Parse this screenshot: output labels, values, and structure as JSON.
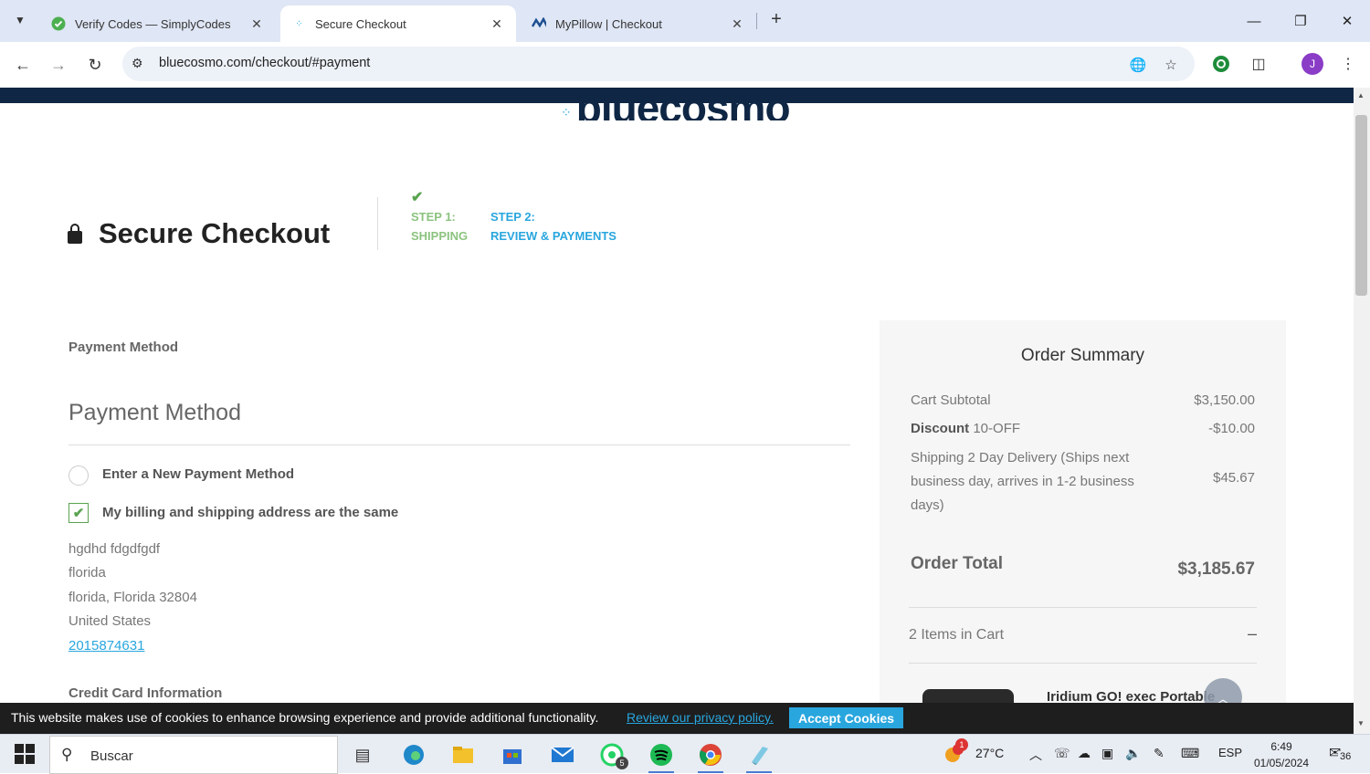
{
  "browser": {
    "tabs": [
      {
        "title": "Verify Codes — SimplyCodes",
        "icon": "simplycodes-icon",
        "active": false
      },
      {
        "title": "Secure Checkout",
        "icon": "bluecosmo-dots-icon",
        "active": true
      },
      {
        "title": "MyPillow | Checkout",
        "icon": "mypillow-icon",
        "active": false
      }
    ],
    "url": "bluecosmo.com/checkout/#payment",
    "profile_initial": "J"
  },
  "page": {
    "logo_text": "bluecosmo",
    "title": "Secure Checkout",
    "steps": [
      {
        "label": "STEP 1:",
        "name": "SHIPPING",
        "done": true
      },
      {
        "label": "STEP 2:",
        "name": "REVIEW & PAYMENTS",
        "done": false
      }
    ],
    "payment": {
      "section_label": "Payment Method",
      "heading": "Payment Method",
      "new_method_label": "Enter a New Payment Method",
      "same_address_label": "My billing and shipping address are the same",
      "same_address_checked": true,
      "address": {
        "name": "hgdhd fdgdfgdf",
        "street": "florida",
        "city_line": "florida, Florida 32804",
        "country": "United States",
        "phone": "2015874631"
      },
      "cc_label": "Credit Card Information"
    },
    "summary": {
      "title": "Order Summary",
      "subtotal_label": "Cart Subtotal",
      "subtotal": "$3,150.00",
      "discount_label": "Discount",
      "discount_code": "10-OFF",
      "discount": "-$10.00",
      "shipping_label": "Shipping 2 Day Delivery (Ships next business day, arrives in 1-2 business days)",
      "shipping": "$45.67",
      "total_label": "Order Total",
      "total": "$3,185.67",
      "items_label": "2 Items in Cart",
      "items_toggle": "–",
      "first_item": "Iridium GO! exec Portable"
    },
    "cookie": {
      "message": "This website makes use of cookies to enhance browsing experience and provide additional functionality.",
      "link": "Review our privacy policy.",
      "accept": "Accept Cookies"
    }
  },
  "taskbar": {
    "search": "Buscar",
    "whatsapp_badge": "5",
    "weather": "27°C",
    "weather_badge": "1",
    "language": "ESP",
    "time": "6:49",
    "date": "01/05/2024",
    "notifications": "36"
  },
  "colors": {
    "brand_navy": "#0f2745",
    "accent_blue": "#29a6de",
    "step_done_green": "#8cc37f",
    "check_green": "#5aa350"
  }
}
